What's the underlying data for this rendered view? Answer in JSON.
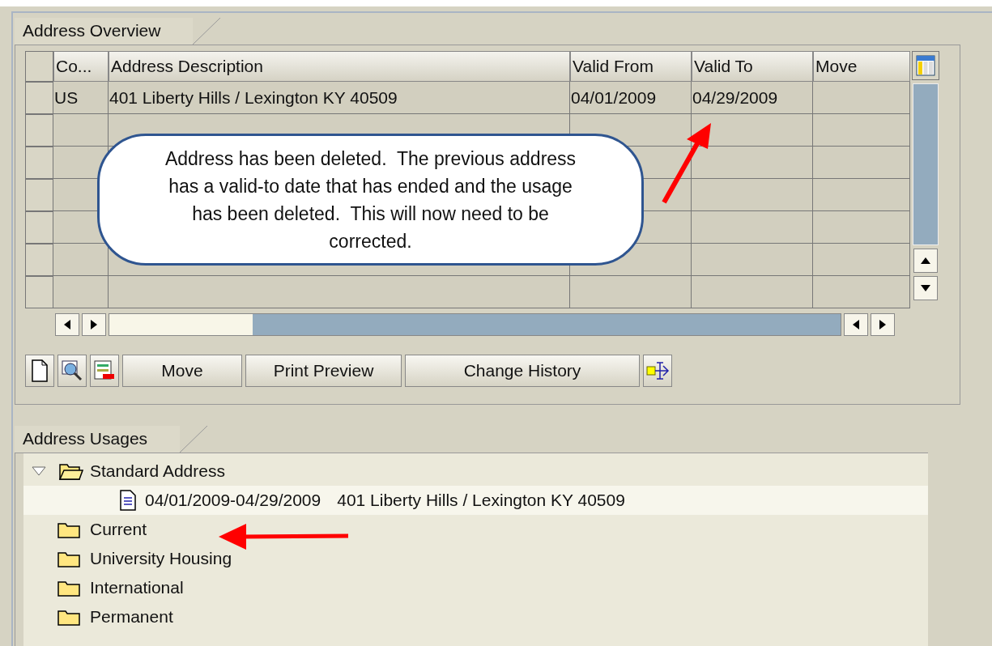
{
  "overview": {
    "title": "Address Overview",
    "table": {
      "columns": [
        "Co...",
        "Address Description",
        "Valid From",
        "Valid To",
        "Move"
      ],
      "rows": [
        {
          "cells": [
            "US",
            "401 Liberty Hills / Lexington KY 40509",
            "04/01/2009",
            "04/29/2009",
            ""
          ]
        }
      ]
    },
    "buttons": [
      {
        "kind": "icon"
      },
      {
        "kind": "icon"
      },
      {
        "kind": "icon"
      },
      {
        "kind": "text",
        "label": "Move"
      },
      {
        "kind": "text",
        "label": "Print Preview"
      },
      {
        "kind": "text",
        "label": "Change History"
      },
      {
        "kind": "icon"
      }
    ]
  },
  "callout": {
    "text": "Address has been deleted.  The previous address has a valid-to date that has ended and the usage has been deleted.  This will now need to be corrected."
  },
  "usages": {
    "title": "Address Usages",
    "tree": [
      {
        "label": "Standard Address",
        "expanded": true,
        "selected": false,
        "children": [
          {
            "dates": "04/01/2009-04/29/2009",
            "address": "401 Liberty Hills / Lexington KY 40509",
            "selected": true
          }
        ]
      },
      {
        "label": "Current",
        "expanded": false,
        "selected": false
      },
      {
        "label": "University Housing",
        "expanded": false,
        "selected": false
      },
      {
        "label": "International",
        "expanded": false,
        "selected": false
      },
      {
        "label": "Permanent",
        "expanded": false,
        "selected": false
      }
    ]
  }
}
